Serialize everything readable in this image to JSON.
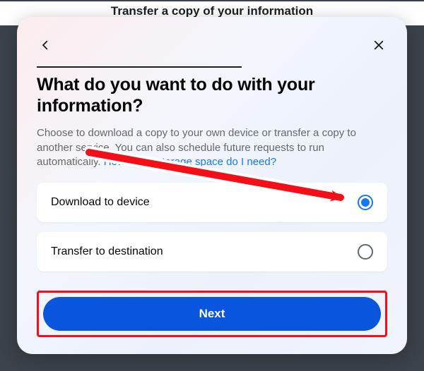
{
  "background": {
    "title": "Transfer a copy of your information"
  },
  "modal": {
    "heading": "What do you want to do with your information?",
    "description_pre": "Choose to download a copy to your own device or transfer a copy to another service. You can also schedule future requests to run automatically. ",
    "description_link": "How much storage space do I need?"
  },
  "options": {
    "download": {
      "label": "Download to device",
      "selected": true
    },
    "transfer": {
      "label": "Transfer to destination",
      "selected": false
    }
  },
  "buttons": {
    "next": "Next"
  }
}
